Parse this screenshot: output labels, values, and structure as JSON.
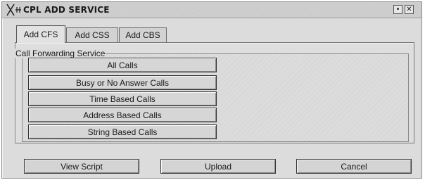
{
  "window": {
    "title": "CPL ADD SERVICE",
    "minimize_glyph": "•",
    "close_glyph": "✕"
  },
  "tabs": [
    {
      "label": "Add CFS",
      "active": true
    },
    {
      "label": "Add CSS",
      "active": false
    },
    {
      "label": "Add CBS",
      "active": false
    }
  ],
  "group": {
    "legend": "Call Forwarding Service",
    "buttons": [
      "All Calls",
      "Busy or No Answer Calls",
      "Time Based Calls",
      "Address Based Calls",
      "String Based Calls"
    ]
  },
  "actions": {
    "view_script": "View Script",
    "upload": "Upload",
    "cancel": "Cancel"
  }
}
